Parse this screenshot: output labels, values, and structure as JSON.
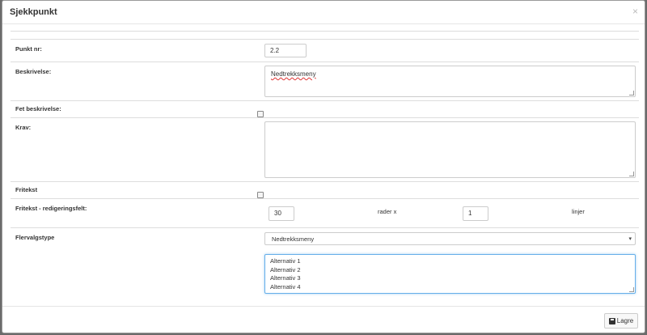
{
  "modal": {
    "title": "Sjekkpunkt",
    "close_label": "×"
  },
  "form": {
    "punkt_nr": {
      "label": "Punkt nr:",
      "value": "2.2"
    },
    "beskrivelse": {
      "label": "Beskrivelse:",
      "value": "Nedtrekksmeny"
    },
    "fet_beskrivelse": {
      "label": "Fet beskrivelse:",
      "checked": false
    },
    "krav": {
      "label": "Krav:",
      "value": ""
    },
    "fritekst": {
      "label": "Fritekst",
      "checked": false
    },
    "fritekst_felt": {
      "label": "Fritekst - redigeringsfelt:",
      "rows_value": "30",
      "rows_label": "rader x",
      "lines_value": "1",
      "lines_label": "linjer"
    },
    "flervalgstype": {
      "label": "Flervalgstype",
      "selected": "Nedtrekksmeny",
      "options": [
        "Alternativ 1",
        "Alternativ 2",
        "Alternativ 3",
        "Alternativ 4"
      ]
    }
  },
  "footer": {
    "save_label": "Lagre"
  }
}
